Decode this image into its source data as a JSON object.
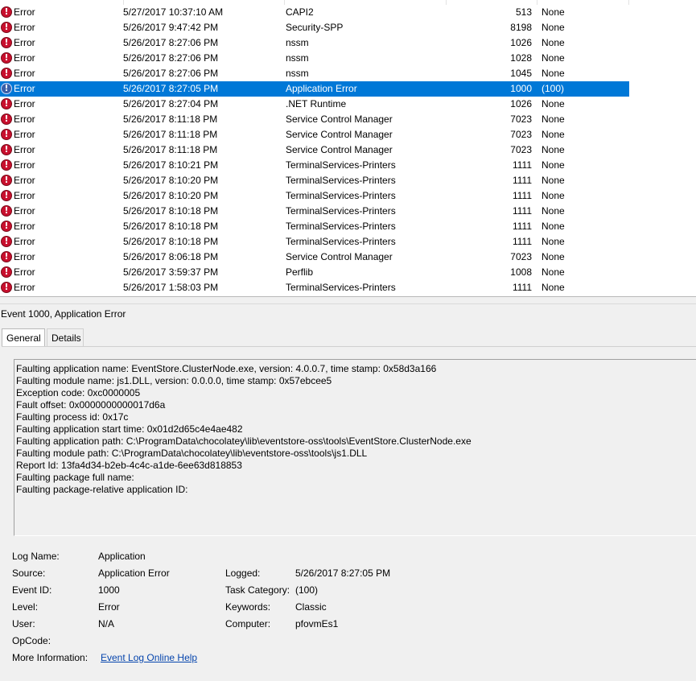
{
  "event_list": {
    "rows": [
      {
        "level": "Error",
        "date": "5/27/2017 10:37:10 AM",
        "source": "CAPI2",
        "event_id": "513",
        "task_category": "None",
        "selected": false
      },
      {
        "level": "Error",
        "date": "5/26/2017 9:47:42 PM",
        "source": "Security-SPP",
        "event_id": "8198",
        "task_category": "None",
        "selected": false
      },
      {
        "level": "Error",
        "date": "5/26/2017 8:27:06 PM",
        "source": "nssm",
        "event_id": "1026",
        "task_category": "None",
        "selected": false
      },
      {
        "level": "Error",
        "date": "5/26/2017 8:27:06 PM",
        "source": "nssm",
        "event_id": "1028",
        "task_category": "None",
        "selected": false
      },
      {
        "level": "Error",
        "date": "5/26/2017 8:27:06 PM",
        "source": "nssm",
        "event_id": "1045",
        "task_category": "None",
        "selected": false
      },
      {
        "level": "Error",
        "date": "5/26/2017 8:27:05 PM",
        "source": "Application Error",
        "event_id": "1000",
        "task_category": "(100)",
        "selected": true
      },
      {
        "level": "Error",
        "date": "5/26/2017 8:27:04 PM",
        "source": ".NET Runtime",
        "event_id": "1026",
        "task_category": "None",
        "selected": false
      },
      {
        "level": "Error",
        "date": "5/26/2017 8:11:18 PM",
        "source": "Service Control Manager",
        "event_id": "7023",
        "task_category": "None",
        "selected": false
      },
      {
        "level": "Error",
        "date": "5/26/2017 8:11:18 PM",
        "source": "Service Control Manager",
        "event_id": "7023",
        "task_category": "None",
        "selected": false
      },
      {
        "level": "Error",
        "date": "5/26/2017 8:11:18 PM",
        "source": "Service Control Manager",
        "event_id": "7023",
        "task_category": "None",
        "selected": false
      },
      {
        "level": "Error",
        "date": "5/26/2017 8:10:21 PM",
        "source": "TerminalServices-Printers",
        "event_id": "1111",
        "task_category": "None",
        "selected": false
      },
      {
        "level": "Error",
        "date": "5/26/2017 8:10:20 PM",
        "source": "TerminalServices-Printers",
        "event_id": "1111",
        "task_category": "None",
        "selected": false
      },
      {
        "level": "Error",
        "date": "5/26/2017 8:10:20 PM",
        "source": "TerminalServices-Printers",
        "event_id": "1111",
        "task_category": "None",
        "selected": false
      },
      {
        "level": "Error",
        "date": "5/26/2017 8:10:18 PM",
        "source": "TerminalServices-Printers",
        "event_id": "1111",
        "task_category": "None",
        "selected": false
      },
      {
        "level": "Error",
        "date": "5/26/2017 8:10:18 PM",
        "source": "TerminalServices-Printers",
        "event_id": "1111",
        "task_category": "None",
        "selected": false
      },
      {
        "level": "Error",
        "date": "5/26/2017 8:10:18 PM",
        "source": "TerminalServices-Printers",
        "event_id": "1111",
        "task_category": "None",
        "selected": false
      },
      {
        "level": "Error",
        "date": "5/26/2017 8:06:18 PM",
        "source": "Service Control Manager",
        "event_id": "7023",
        "task_category": "None",
        "selected": false
      },
      {
        "level": "Error",
        "date": "5/26/2017 3:59:37 PM",
        "source": "Perflib",
        "event_id": "1008",
        "task_category": "None",
        "selected": false
      },
      {
        "level": "Error",
        "date": "5/26/2017 1:58:03 PM",
        "source": "TerminalServices-Printers",
        "event_id": "1111",
        "task_category": "None",
        "selected": false
      }
    ],
    "level_icon": "error-icon"
  },
  "details": {
    "title": "Event 1000, Application Error",
    "tabs": [
      "General",
      "Details"
    ],
    "active_tab": "General",
    "description_lines": [
      "Faulting application name: EventStore.ClusterNode.exe, version: 4.0.0.7, time stamp: 0x58d3a166",
      "Faulting module name: js1.DLL, version: 0.0.0.0, time stamp: 0x57ebcee5",
      "Exception code: 0xc0000005",
      "Fault offset: 0x0000000000017d6a",
      "Faulting process id: 0x17c",
      "Faulting application start time: 0x01d2d65c4e4ae482",
      "Faulting application path: C:\\ProgramData\\chocolatey\\lib\\eventstore-oss\\tools\\EventStore.ClusterNode.exe",
      "Faulting module path: C:\\ProgramData\\chocolatey\\lib\\eventstore-oss\\tools\\js1.DLL",
      "Report Id: 13fa4d34-b2eb-4c4c-a1de-6ee63d818853",
      "Faulting package full name:",
      "Faulting package-relative application ID:"
    ],
    "props": {
      "log_name_label": "Log Name:",
      "log_name": "Application",
      "source_label": "Source:",
      "source": "Application Error",
      "logged_label": "Logged:",
      "logged": "5/26/2017 8:27:05 PM",
      "event_id_label": "Event ID:",
      "event_id": "1000",
      "task_category_label": "Task Category:",
      "task_category": "(100)",
      "level_label": "Level:",
      "level": "Error",
      "keywords_label": "Keywords:",
      "keywords": "Classic",
      "user_label": "User:",
      "user": "N/A",
      "computer_label": "Computer:",
      "computer": "pfovmEs1",
      "opcode_label": "OpCode:",
      "more_info_label": "More Information:",
      "more_info_link": "Event Log Online Help"
    }
  }
}
